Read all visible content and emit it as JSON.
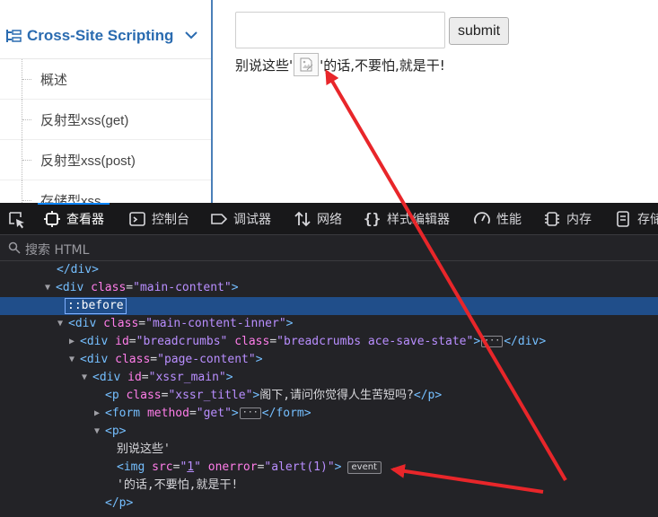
{
  "sidebar": {
    "section_title": "Cross-Site Scripting",
    "items": [
      {
        "label": "概述"
      },
      {
        "label": "反射型xss(get)"
      },
      {
        "label": "反射型xss(post)"
      },
      {
        "label": "存储型xss"
      }
    ]
  },
  "main": {
    "input_value": "",
    "submit_label": "submit",
    "result_before": "别说这些'",
    "result_after": "'的话,不要怕,就是干!"
  },
  "devtools": {
    "tabs": [
      {
        "label": "查看器",
        "icon": "inspector-icon",
        "active": true
      },
      {
        "label": "控制台",
        "icon": "console-icon"
      },
      {
        "label": "调试器",
        "icon": "debugger-icon"
      },
      {
        "label": "网络",
        "icon": "network-icon"
      },
      {
        "label": "样式编辑器",
        "icon": "style-editor-icon"
      },
      {
        "label": "性能",
        "icon": "performance-icon"
      },
      {
        "label": "内存",
        "icon": "memory-icon"
      },
      {
        "label": "存储",
        "icon": "storage-icon"
      }
    ],
    "search_placeholder": "搜索 HTML",
    "tree": {
      "r0_tag": "</div>",
      "r1": {
        "tag": "div",
        "attr": "class",
        "val": "main-content"
      },
      "r2_pseudo": "::before",
      "r3": {
        "tag": "div",
        "attr": "class",
        "val": "main-content-inner"
      },
      "r4": {
        "tag": "div",
        "attr1": "id",
        "val1": "breadcrumbs",
        "attr2": "class",
        "val2": "breadcrumbs ace-save-state",
        "close": "</div>"
      },
      "r5": {
        "tag": "div",
        "attr": "class",
        "val": "page-content"
      },
      "r6": {
        "tag": "div",
        "attr": "id",
        "val": "xssr_main"
      },
      "r7": {
        "tag": "p",
        "attr": "class",
        "val": "xssr_title",
        "text": "阁下,请问你觉得人生苦短吗?",
        "close": "</p>"
      },
      "r8": {
        "tag": "form",
        "attr": "method",
        "val": "get",
        "close": "</form>"
      },
      "r9_tag": "<p>",
      "r10_text": "别说这些'",
      "r11": {
        "tag": "img",
        "attr1": "src",
        "val1": "1",
        "attr2": "onerror",
        "val2": "alert(1)",
        "badge": "event"
      },
      "r12_text": "'的话,不要怕,就是干!",
      "r13_tag": "</p>"
    }
  },
  "colors": {
    "arrow": "#e8262a",
    "sidebar_title": "#2a6bb0",
    "devtools_bg": "#232327",
    "selected_row": "#204e8a",
    "tag": "#75bfff",
    "attr": "#ff7de9",
    "value": "#b98eff"
  }
}
